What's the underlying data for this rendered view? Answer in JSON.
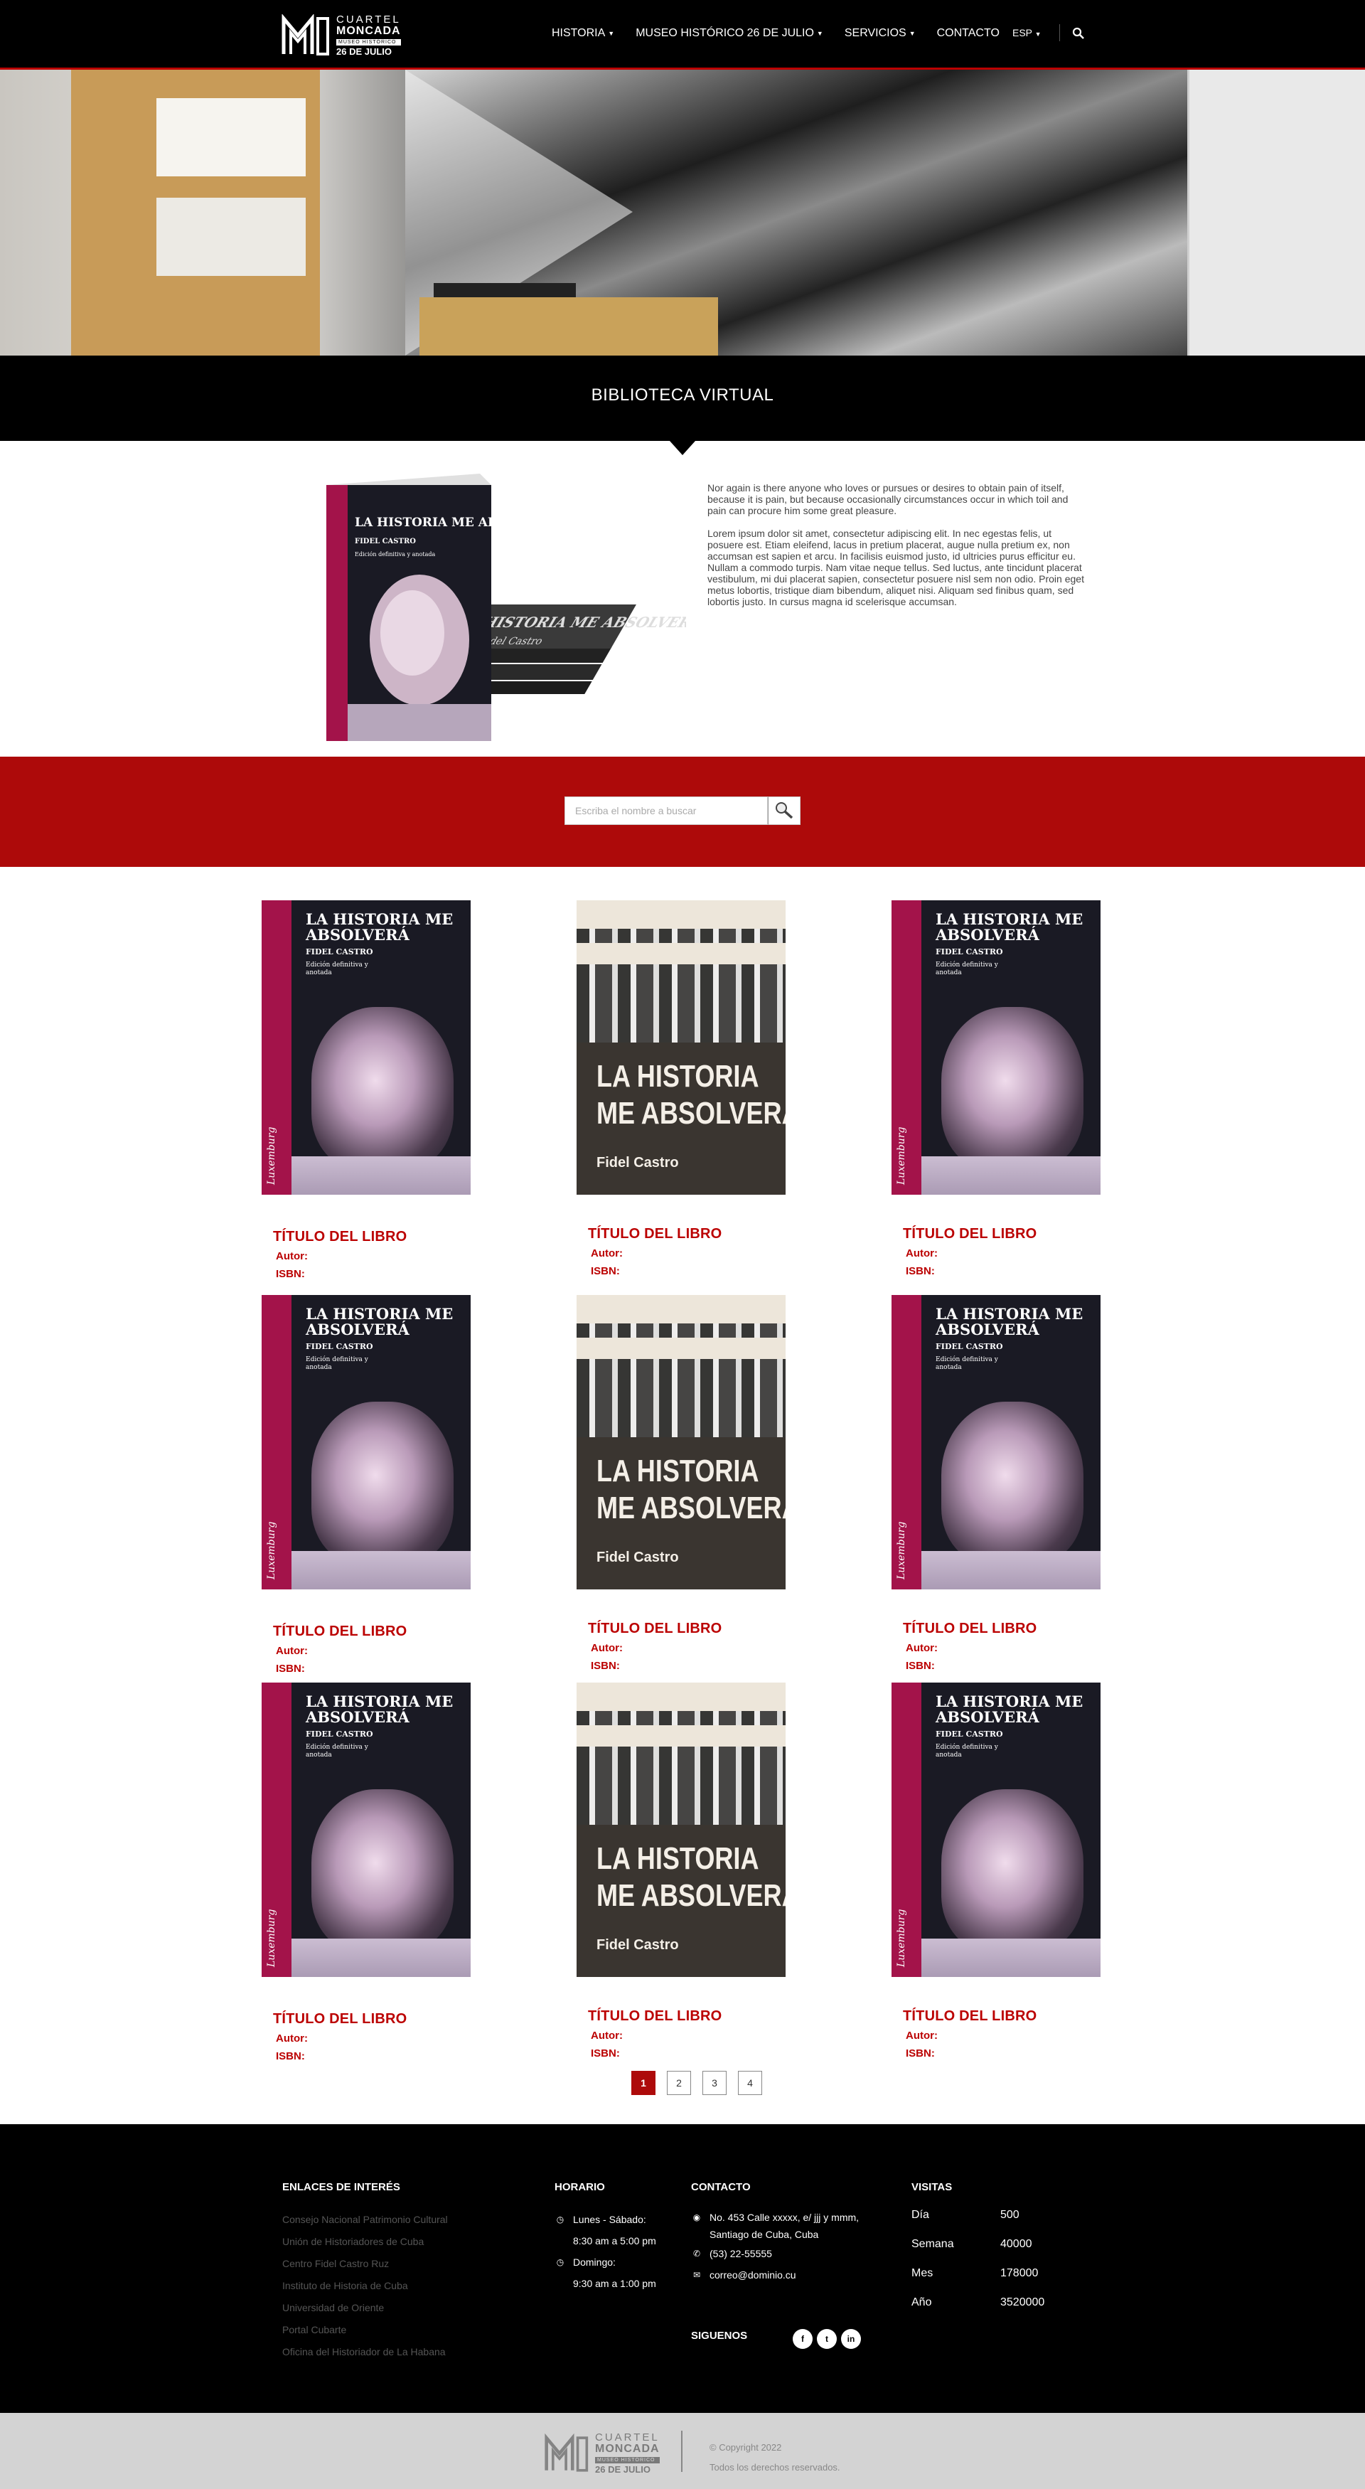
{
  "header": {
    "logo": {
      "line1": "CUARTEL",
      "line2": "MONCADA",
      "line3": "MUSEO HISTÓRICO",
      "line4": "26 DE JULIO"
    },
    "nav": [
      {
        "label": "HISTORIA",
        "has_menu": true
      },
      {
        "label": "MUSEO HISTÓRICO 26 DE JULIO",
        "has_menu": true
      },
      {
        "label": "SERVICIOS",
        "has_menu": true
      },
      {
        "label": "CONTACTO",
        "has_menu": false
      }
    ],
    "language": "ESP",
    "search_icon": "search-icon"
  },
  "page_title": "BIBLIOTECA VIRTUAL",
  "intro": {
    "p1": "Nor again is there anyone who loves or pursues or desires to obtain pain of itself, because it is pain, but because occasionally circumstances occur in which toil and pain can procure him some great pleasure.",
    "p2": "Lorem ipsum dolor sit amet, consectetur adipiscing elit. In nec egestas felis, ut posuere est. Etiam eleifend, lacus in pretium placerat, augue nulla pretium ex, non accumsan est sapien et arcu. In facilisis euismod justo, id ultricies purus efficitur eu. Nullam a commodo turpis. Nam vitae neque tellus. Sed luctus, ante tincidunt placerat vestibulum, mi dui placerat sapien, consectetur posuere nisl sem non odio. Proin eget metus lobortis, tristique diam bibendum, aliquet nisi. Aliquam sed finibus quam, sed lobortis justo. In cursus magna id scelerisque accumsan.",
    "book": {
      "title": "LA HISTORIA ME ABSOLVERÁ",
      "author": "FIDEL CASTRO",
      "subtitle": "Edición definitiva y anotada",
      "back_title": "HISTORIA ME ABSOLVERÁ",
      "back_author": "Fidel Castro"
    }
  },
  "search": {
    "placeholder": "Escriba el nombre a buscar",
    "icon": "magnifier-icon"
  },
  "covers": {
    "a": {
      "title": "LA HISTORIA ME ABSOLVERÁ",
      "author": "FIDEL CASTRO",
      "subtitle": "Edición definitiva y anotada",
      "publisher": "Luxemburg"
    },
    "b": {
      "title_line1": "LA HISTORIA",
      "title_line2": "ME ABSOLVERA",
      "author": "Fidel Castro"
    }
  },
  "books": [
    {
      "cover": "a",
      "title": "TÍTULO DEL LIBRO",
      "author_label": "Autor:",
      "isbn_label": "ISBN:"
    },
    {
      "cover": "b",
      "title": "TÍTULO DEL LIBRO",
      "author_label": "Autor:",
      "isbn_label": "ISBN:"
    },
    {
      "cover": "a",
      "title": "TÍTULO DEL LIBRO",
      "author_label": "Autor:",
      "isbn_label": "ISBN:"
    },
    {
      "cover": "a",
      "title": "TÍTULO DEL LIBRO",
      "author_label": "Autor:",
      "isbn_label": "ISBN:"
    },
    {
      "cover": "b",
      "title": "TÍTULO DEL LIBRO",
      "author_label": "Autor:",
      "isbn_label": "ISBN:"
    },
    {
      "cover": "a",
      "title": "TÍTULO DEL LIBRO",
      "author_label": "Autor:",
      "isbn_label": "ISBN:"
    },
    {
      "cover": "a",
      "title": "TÍTULO DEL LIBRO",
      "author_label": "Autor:",
      "isbn_label": "ISBN:"
    },
    {
      "cover": "b",
      "title": "TÍTULO DEL LIBRO",
      "author_label": "Autor:",
      "isbn_label": "ISBN:"
    },
    {
      "cover": "a",
      "title": "TÍTULO DEL LIBRO",
      "author_label": "Autor:",
      "isbn_label": "ISBN:"
    }
  ],
  "pagination": {
    "pages": [
      "1",
      "2",
      "3",
      "4"
    ],
    "current": "1"
  },
  "footer": {
    "links": {
      "heading": "ENLACES DE INTERÉS",
      "items": [
        "Consejo Nacional Patrimonio Cultural",
        "Unión de Historiadores de Cuba",
        "Centro Fidel Castro Ruz",
        "Instituto de Historia de Cuba",
        "Universidad de Oriente",
        "Portal Cubarte",
        "Oficina del Historiador de La Habana"
      ]
    },
    "schedule": {
      "heading": "HORARIO",
      "day1": "Lunes - Sábado:",
      "hours1": "8:30 am a 5:00 pm",
      "day2": "Domingo:",
      "hours2": "9:30 am a 1:00 pm"
    },
    "contact": {
      "heading": "CONTACTO",
      "address": "No. 453 Calle xxxxx, e/ jjj y mmm, Santiago de Cuba, Cuba",
      "phone": "(53) 22-55555",
      "email": "correo@dominio.cu"
    },
    "social": {
      "heading": "SIGUENOS",
      "icons": [
        "f",
        "t",
        "in"
      ]
    },
    "visits": {
      "heading": "VISITAS",
      "rows": [
        {
          "label": "Día",
          "value": "500"
        },
        {
          "label": "Semana",
          "value": "40000"
        },
        {
          "label": "Mes",
          "value": "178000"
        },
        {
          "label": "Año",
          "value": "3520000"
        }
      ]
    }
  },
  "bottom": {
    "copyright": "© Copyright 2022",
    "rights": "Todos los derechos reservados."
  },
  "colors": {
    "accent": "#ad0a0a",
    "header": "#000000",
    "bottom_bar": "#d3d3d3"
  }
}
